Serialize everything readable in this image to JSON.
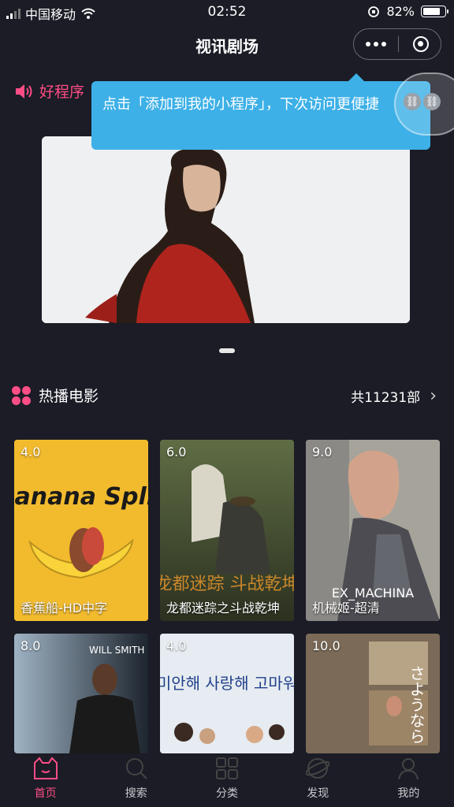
{
  "status_bar": {
    "carrier": "中国移动",
    "time": "02:52",
    "battery": "82%",
    "battery_level": 0.82
  },
  "nav": {
    "title": "视讯剧场"
  },
  "notice": {
    "text": "好程序"
  },
  "tooltip": {
    "text": "点击「添加到我的小程序」，下次访问更便捷"
  },
  "section": {
    "title": "热播电影",
    "count": "共11231部"
  },
  "movies": [
    {
      "score": "4.0",
      "title": "香蕉船-HD中字",
      "poster_title": "Banana Split"
    },
    {
      "score": "6.0",
      "title": "龙都迷踪之斗战乾坤",
      "poster_title": "龙都迷踪 斗战乾坤"
    },
    {
      "score": "9.0",
      "title": "机械姬-超清",
      "poster_title": "EX_MACHINA"
    },
    {
      "score": "8.0",
      "title": "",
      "poster_title": "WILL SMITH"
    },
    {
      "score": "4.0",
      "title": "",
      "poster_title": "미안해 사랑해 고마워"
    },
    {
      "score": "10.0",
      "title": "",
      "poster_title": "さようなら"
    }
  ],
  "tabs": [
    {
      "label": "首页",
      "icon": "home-icon",
      "active": true
    },
    {
      "label": "搜索",
      "icon": "search-icon"
    },
    {
      "label": "分类",
      "icon": "category-icon"
    },
    {
      "label": "发现",
      "icon": "discover-icon"
    },
    {
      "label": "我的",
      "icon": "profile-icon"
    }
  ],
  "colors": {
    "accent": "#ff4d86",
    "background": "#1b1c26",
    "tooltip": "#3db0e7"
  }
}
